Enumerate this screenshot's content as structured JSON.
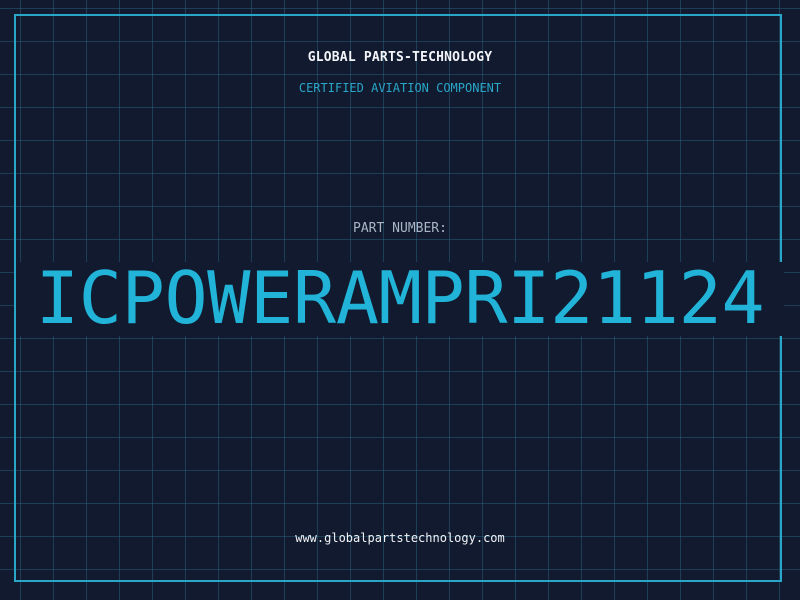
{
  "label": {
    "company_name": "GLOBAL PARTS-TECHNOLOGY",
    "subtitle": "CERTIFIED AVIATION COMPONENT",
    "part_label": "PART NUMBER:",
    "part_number": "ICPOWERAMPRI21124",
    "website": "www.globalpartstechnology.com"
  },
  "colors": {
    "background": "#111a2e",
    "accent": "#2aa6c8",
    "part_number": "#21b4d8",
    "text_primary": "#f2f4f8",
    "text_secondary": "#a9b6c6"
  }
}
